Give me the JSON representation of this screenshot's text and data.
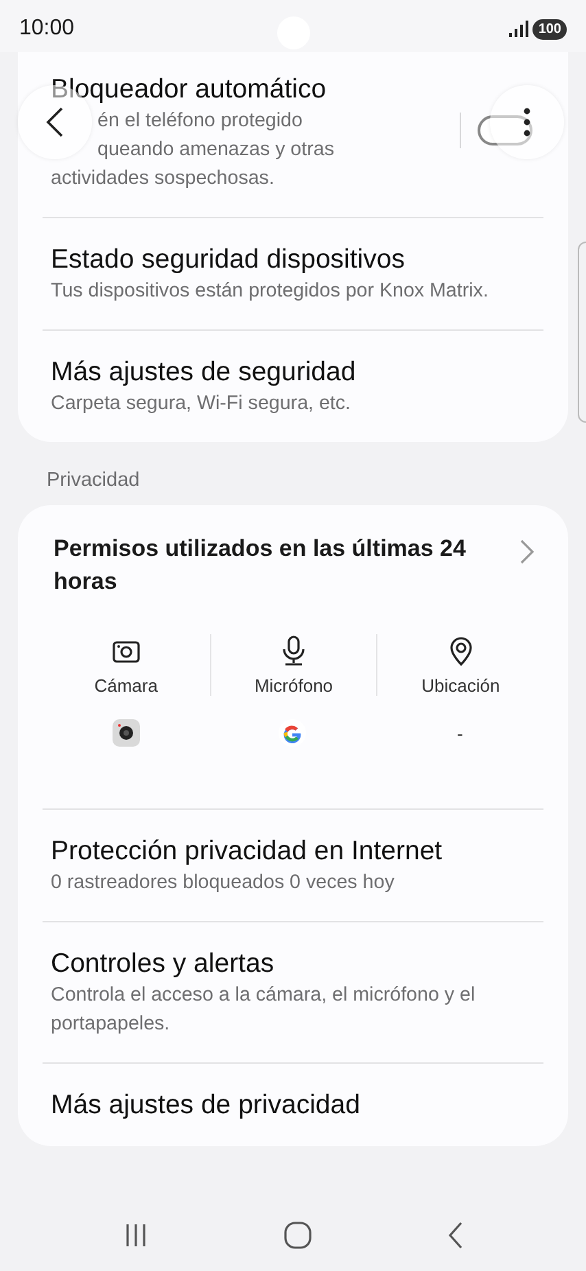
{
  "status_bar": {
    "time": "10:00",
    "battery": "100"
  },
  "header": {
    "toggle": {
      "on": false
    }
  },
  "security_items": [
    {
      "title": "Bloqueador automático",
      "subtitle_lines": [
        "én el teléfono protegido",
        "queando amenazas y otras",
        "actividades sospechosas."
      ]
    },
    {
      "title": "Estado seguridad dispositivos",
      "subtitle": "Tus dispositivos están protegidos por Knox Matrix."
    },
    {
      "title": "Más ajustes de seguridad",
      "subtitle": "Carpeta segura, Wi-Fi segura, etc."
    }
  ],
  "privacy": {
    "label": "Privacidad",
    "permissions": {
      "title": "Permisos utilizados en las últimas 24 horas",
      "columns": [
        {
          "kind": "camera",
          "label": "Cámara",
          "app": {
            "kind": "camera"
          }
        },
        {
          "kind": "microphone",
          "label": "Micrófono",
          "app": {
            "kind": "google"
          }
        },
        {
          "kind": "location",
          "label": "Ubicación",
          "usage": "-"
        }
      ]
    },
    "items": [
      {
        "title": "Protección privacidad en Internet",
        "subtitle": "0 rastreadores bloqueados 0 veces hoy"
      },
      {
        "title": "Controles y alertas",
        "subtitle": "Controla el acceso a la cámara, el micrófono y el portapapeles."
      },
      {
        "title": "Más ajustes de privacidad"
      }
    ]
  }
}
